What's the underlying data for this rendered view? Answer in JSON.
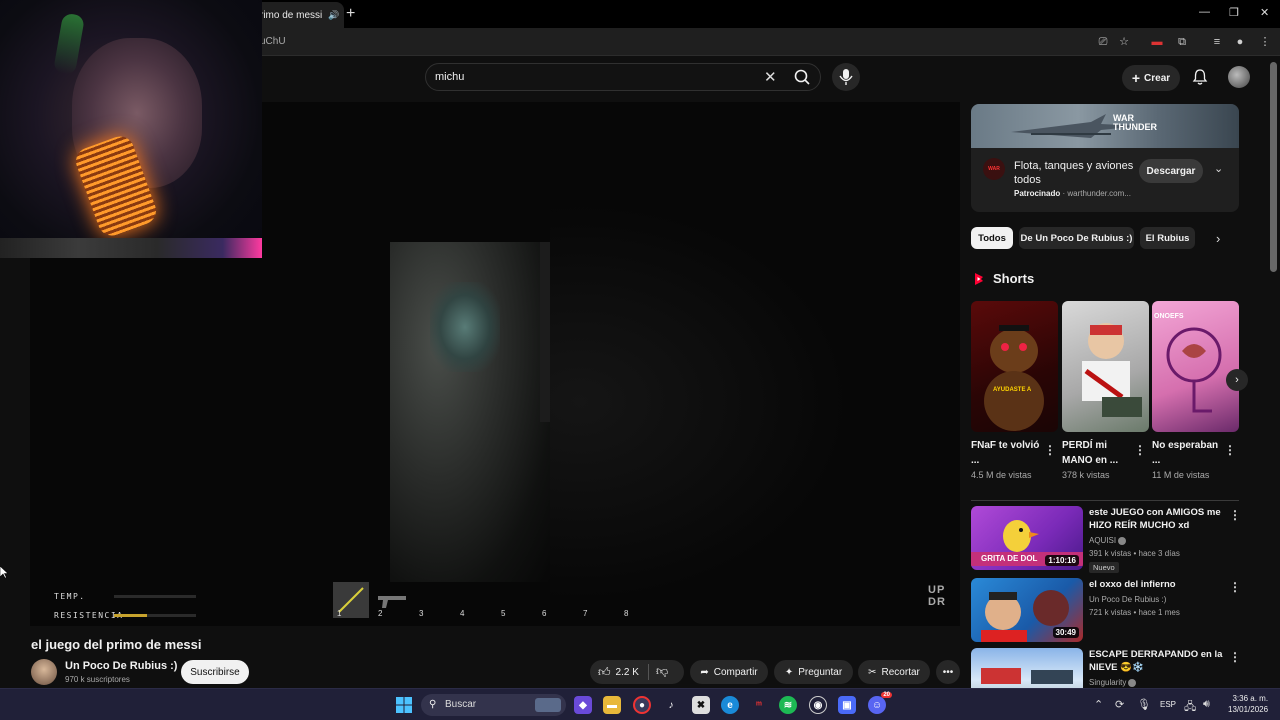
{
  "browser": {
    "tab_title": "rimo de messi",
    "url_fragment": "uChU",
    "tab_close": "✕",
    "new_tab": "+"
  },
  "youtube": {
    "search": {
      "query": "michu"
    },
    "create_label": "Crear"
  },
  "player": {
    "hud": {
      "temp_label": "TEMP.",
      "resistance_label": "RESISTENCIA",
      "temp_level": 0,
      "resistance_level": 0.4
    },
    "inventory_slots": [
      "1",
      "2",
      "3",
      "4",
      "5",
      "6",
      "7",
      "8"
    ],
    "watermark": [
      "UP",
      "DR"
    ]
  },
  "video": {
    "title": "el juego del primo de messi",
    "channel_name": "Un Poco De Rubius :)",
    "subscribers": "970 k suscriptores",
    "subscribe_label": "Suscribirse",
    "likes": "2.2 K",
    "share_label": "Compartir",
    "ask_label": "Preguntar",
    "clip_label": "Recortar"
  },
  "ad": {
    "title": "Flota, tanques y aviones todos",
    "sponsored_label": "Patrocinado",
    "domain": "warthunder.com...",
    "download_label": "Descargar"
  },
  "chips": [
    "Todos",
    "De Un Poco De Rubius :)",
    "El Rubius"
  ],
  "shorts": {
    "section_title": "Shorts",
    "items": [
      {
        "title": "FNaF te volvió ...",
        "views": "4.5 M de vistas",
        "thumb_text": "AYUDASTE A"
      },
      {
        "title": "PERDÍ mi MANO en ...",
        "views": "378 k vistas",
        "thumb_text": ""
      },
      {
        "title": "No esperaban ...",
        "views": "11 M de vistas",
        "thumb_text": "ONOEFS"
      }
    ]
  },
  "recommendations": [
    {
      "title": "este JUEGO con AMIGOS me HIZO REÍR MUCHO xd",
      "channel": "AQUISI",
      "meta": "391 k vistas • hace 3 días",
      "badge": "Nuevo",
      "duration": "1:10:16",
      "thumb_text": "GRITA DE DOL"
    },
    {
      "title": "el oxxo del infierno",
      "channel": "Un Poco De Rubius :)",
      "meta": "721 k vistas • hace 1 mes",
      "badge": "",
      "duration": "30:49",
      "thumb_text": ""
    },
    {
      "title": "ESCAPE DERRAPANDO en la NIEVE 😎❄️",
      "channel": "Singularity",
      "meta": "",
      "badge": "",
      "duration": "",
      "thumb_text": ""
    }
  ],
  "taskbar": {
    "search_label": "Buscar",
    "language": "ESP",
    "time": "3:36 a. m.",
    "date": "13/01/2026",
    "discord_badge": "20"
  },
  "colors": {
    "background": "#0f0f0f",
    "accent_red": "#ff0033",
    "resistance_bar": "#c7a32d",
    "taskbar": "#202038"
  }
}
